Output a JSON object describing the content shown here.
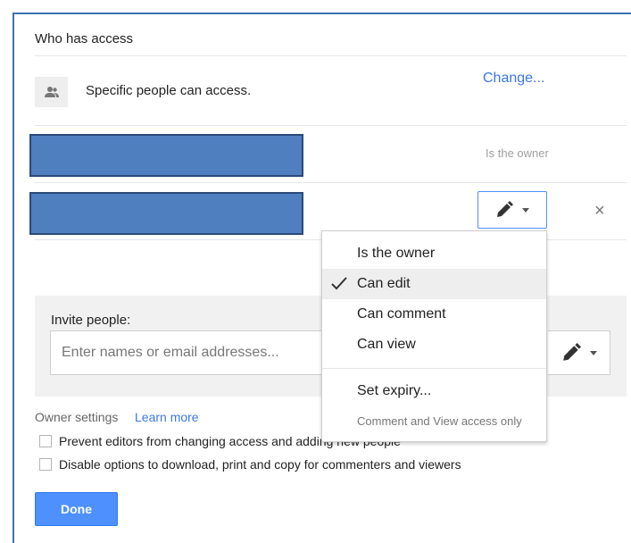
{
  "dialog": {
    "title": "Who has access",
    "access_text": "Specific people can access.",
    "change_link": "Change...",
    "owner_label": "Is the owner",
    "remove_symbol": "×"
  },
  "invite": {
    "label": "Invite people:",
    "placeholder": "Enter names or email addresses..."
  },
  "owner_settings": {
    "label": "Owner settings",
    "learn_more": "Learn more",
    "option_prevent": "Prevent editors from changing access and adding new people",
    "option_disable": "Disable options to download, print and copy for commenters and viewers"
  },
  "done_label": "Done",
  "dropdown": {
    "items": [
      {
        "label": "Is the owner",
        "selected": false
      },
      {
        "label": "Can edit",
        "selected": true
      },
      {
        "label": "Can comment",
        "selected": false
      },
      {
        "label": "Can view",
        "selected": false
      }
    ],
    "set_expiry": "Set expiry...",
    "note": "Comment and View access only"
  },
  "icons": {
    "people": "people-icon",
    "pencil": "pencil-icon",
    "caret": "caret-down-icon",
    "check": "checkmark-icon",
    "close": "close-icon"
  },
  "colors": {
    "accent": "#4d90fe",
    "link": "#3b78e7",
    "redaction": "#4f7fbf"
  }
}
